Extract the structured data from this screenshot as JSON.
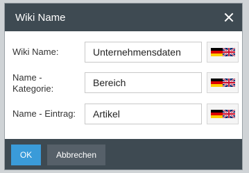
{
  "dialog": {
    "title": "Wiki Name",
    "close_label": "close",
    "rows": [
      {
        "label": "Wiki Name:",
        "value": "Unternehmensdaten",
        "language": "Deutsch / English"
      },
      {
        "label": "Name -\nKategorie:",
        "value": "Bereich",
        "language": "Deutsch / English"
      },
      {
        "label": "Name - Eintrag:",
        "value": "Artikel",
        "language": "Deutsch / English"
      }
    ],
    "ok_label": "OK",
    "cancel_label": "Abbrechen"
  },
  "colors": {
    "titlebar": "#3e4a52",
    "ok_button": "#3a9bd9",
    "cancel_button": "#566069"
  },
  "icons": [
    "close-icon",
    "flag-de-icon",
    "flag-uk-icon"
  ]
}
